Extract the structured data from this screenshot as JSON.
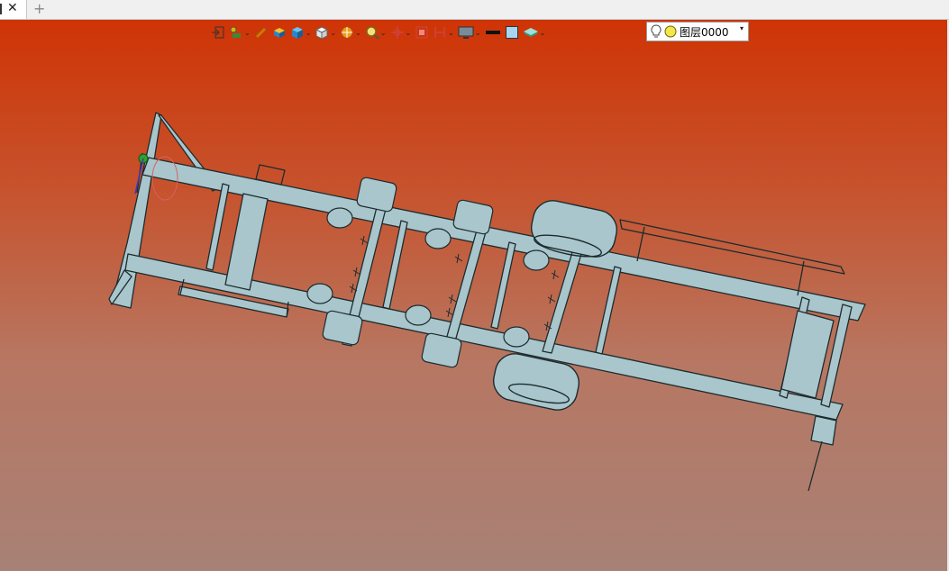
{
  "tabs": {
    "close_glyph": "✕",
    "add_glyph": "+"
  },
  "toolbar": {
    "icons": [
      "exit-icon",
      "sketch-icon",
      "pen-icon",
      "box-icon",
      "cube-icon",
      "view-cube-icon",
      "render-icon",
      "zoom-icon",
      "pan-icon",
      "fit-icon",
      "section-icon",
      "display-icon",
      "line-color-icon",
      "fill-icon",
      "layer-stack-icon"
    ],
    "dropdown_glyph": "⌄"
  },
  "layer": {
    "name": "图层0000",
    "arrow": "▾",
    "lamp_color": "#f5e64b"
  },
  "colors": {
    "background_top": "#cf3405",
    "background_bottom": "#a88176",
    "model": "#a8c6cc",
    "model_edge": "#1d2b2e"
  }
}
